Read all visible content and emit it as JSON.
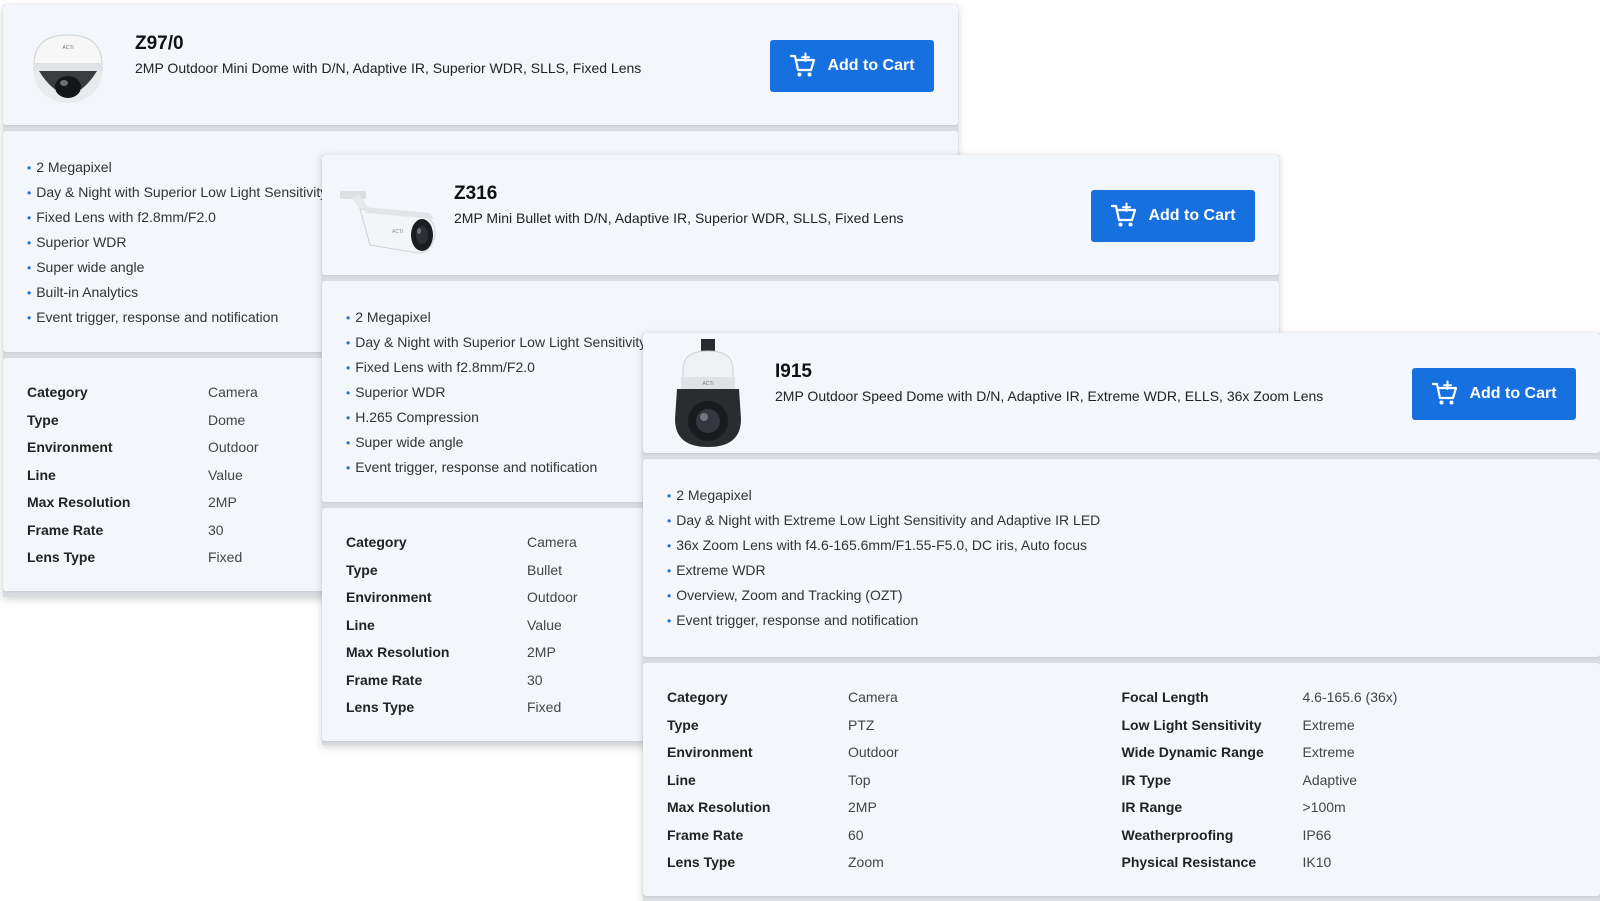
{
  "cart_label": "Add to Cart",
  "accent_color": "#1670e0",
  "products": [
    {
      "model": "Z97/0",
      "description": "2MP Outdoor Mini Dome with D/N, Adaptive IR, Superior WDR, SLLS, Fixed Lens",
      "features": [
        "2 Megapixel",
        "Day & Night with Superior Low Light Sensitivity",
        "Fixed Lens with f2.8mm/F2.0",
        "Superior WDR",
        "Super wide angle",
        "Built-in Analytics",
        "Event trigger, response and notification"
      ],
      "specs": [
        {
          "label": "Category",
          "value": "Camera"
        },
        {
          "label": "Type",
          "value": "Dome"
        },
        {
          "label": "Environment",
          "value": "Outdoor"
        },
        {
          "label": "Line",
          "value": "Value"
        },
        {
          "label": "Max Resolution",
          "value": "2MP"
        },
        {
          "label": "Frame Rate",
          "value": "30"
        },
        {
          "label": "Lens Type",
          "value": "Fixed"
        }
      ]
    },
    {
      "model": "Z316",
      "description": "2MP Mini Bullet with D/N, Adaptive IR, Superior WDR, SLLS, Fixed Lens",
      "features": [
        "2 Megapixel",
        "Day & Night with Superior Low Light Sensitivity",
        "Fixed Lens with f2.8mm/F2.0",
        "Superior WDR",
        "H.265 Compression",
        "Super wide angle",
        "Event trigger, response and notification"
      ],
      "specs": [
        {
          "label": "Category",
          "value": "Camera"
        },
        {
          "label": "Type",
          "value": "Bullet"
        },
        {
          "label": "Environment",
          "value": "Outdoor"
        },
        {
          "label": "Line",
          "value": "Value"
        },
        {
          "label": "Max Resolution",
          "value": "2MP"
        },
        {
          "label": "Frame Rate",
          "value": "30"
        },
        {
          "label": "Lens Type",
          "value": "Fixed"
        }
      ]
    },
    {
      "model": "I915",
      "description": "2MP Outdoor Speed Dome with D/N, Adaptive IR, Extreme WDR, ELLS, 36x Zoom Lens",
      "features": [
        "2 Megapixel",
        "Day & Night with Extreme Low Light Sensitivity and Adaptive IR LED",
        "36x Zoom Lens with f4.6-165.6mm/F1.55-F5.0, DC iris, Auto focus",
        "Extreme WDR",
        "Overview, Zoom and Tracking (OZT)",
        "Event trigger, response and notification"
      ],
      "specs": [
        {
          "label": "Category",
          "value": "Camera"
        },
        {
          "label": "Type",
          "value": "PTZ"
        },
        {
          "label": "Environment",
          "value": "Outdoor"
        },
        {
          "label": "Line",
          "value": "Top"
        },
        {
          "label": "Max Resolution",
          "value": "2MP"
        },
        {
          "label": "Frame Rate",
          "value": "60"
        },
        {
          "label": "Lens Type",
          "value": "Zoom"
        }
      ],
      "specs2": [
        {
          "label": "Focal Length",
          "value": "4.6-165.6 (36x)"
        },
        {
          "label": "Low Light Sensitivity",
          "value": "Extreme"
        },
        {
          "label": "Wide Dynamic Range",
          "value": "Extreme"
        },
        {
          "label": "IR Type",
          "value": "Adaptive"
        },
        {
          "label": "IR Range",
          "value": ">100m"
        },
        {
          "label": "Weatherproofing",
          "value": "IP66"
        },
        {
          "label": "Physical Resistance",
          "value": "IK10"
        }
      ]
    }
  ]
}
